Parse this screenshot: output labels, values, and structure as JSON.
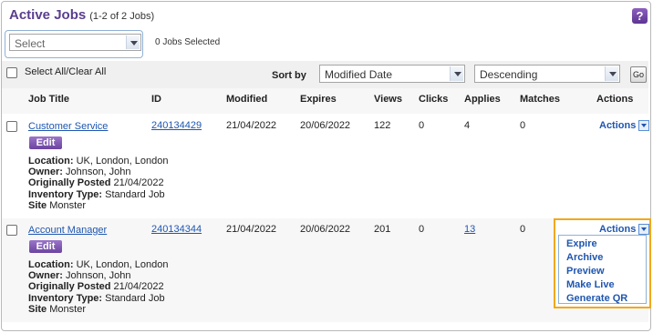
{
  "header": {
    "title": "Active Jobs",
    "count": "(1-2 of 2 Jobs)",
    "help_label": "?"
  },
  "bulk": {
    "select_value": "Select",
    "jobs_selected": "0 Jobs Selected"
  },
  "sortbar": {
    "select_all_label": "Select All/Clear All",
    "sort_by_label": "Sort by",
    "sort_field": "Modified Date",
    "sort_order": "Descending",
    "go_label": "Go"
  },
  "columns": {
    "job_title": "Job Title",
    "id": "ID",
    "modified": "Modified",
    "expires": "Expires",
    "views": "Views",
    "clicks": "Clicks",
    "applies": "Applies",
    "matches": "Matches",
    "actions": "Actions"
  },
  "rows": [
    {
      "title": "Customer Service",
      "id": "240134429",
      "modified": "21/04/2022",
      "expires": "20/06/2022",
      "views": "122",
      "clicks": "0",
      "applies": "4",
      "matches": "0",
      "actions_label": "Actions",
      "edit_label": "Edit",
      "location_label": "Location:",
      "location": "UK, London, London",
      "owner_label": "Owner:",
      "owner": "Johnson, John",
      "posted_label": "Originally Posted",
      "posted": "21/04/2022",
      "inventory_label": "Inventory Type:",
      "inventory": "Standard Job",
      "site_label": "Site",
      "site": "Monster"
    },
    {
      "title": "Account Manager",
      "id": "240134344",
      "modified": "21/04/2022",
      "expires": "20/06/2022",
      "views": "201",
      "clicks": "0",
      "applies": "13",
      "matches": "0",
      "actions_label": "Actions",
      "edit_label": "Edit",
      "location_label": "Location:",
      "location": "UK, London, London",
      "owner_label": "Owner:",
      "owner": "Johnson, John",
      "posted_label": "Originally Posted",
      "posted": "21/04/2022",
      "inventory_label": "Inventory Type:",
      "inventory": "Standard Job",
      "site_label": "Site",
      "site": "Monster"
    }
  ],
  "actions_menu": [
    "Expire",
    "Archive",
    "Preview",
    "Make Live",
    "Generate QR"
  ],
  "colors": {
    "title_purple": "#5a3e8e",
    "link_blue": "#1f56b0",
    "menu_highlight": "#f0a818"
  }
}
